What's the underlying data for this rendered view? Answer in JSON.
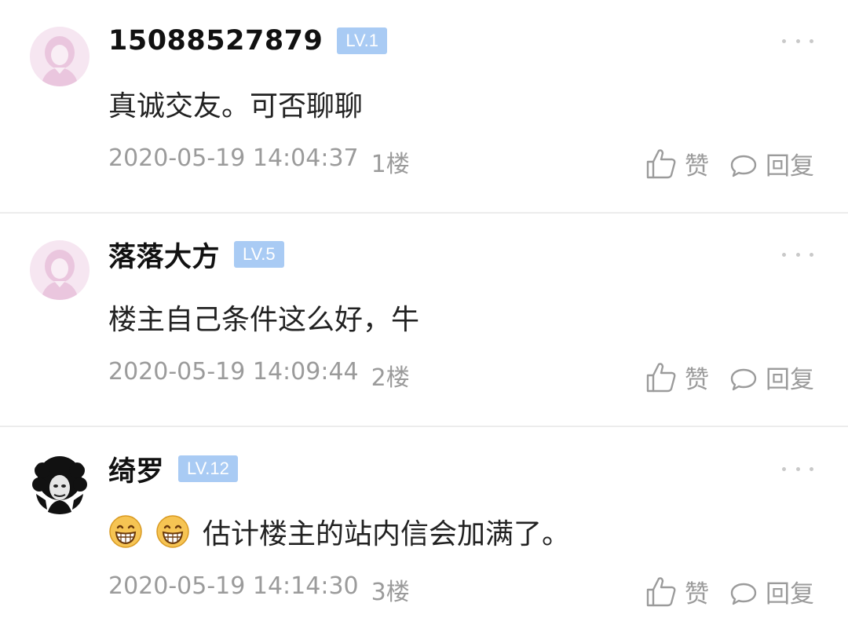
{
  "comments": [
    {
      "username": "15088527879",
      "level": "LV.1",
      "avatar": "female-silhouette-avatar",
      "emojis": [],
      "text": "真诚交友。可否聊聊",
      "timestamp": "2020-05-19 14:04:37",
      "floor": "1楼",
      "like_label": "赞",
      "reply_label": "回复"
    },
    {
      "username": "落落大方",
      "level": "LV.5",
      "avatar": "female-silhouette-avatar",
      "emojis": [],
      "text": "楼主自己条件这么好，牛",
      "timestamp": "2020-05-19 14:09:44",
      "floor": "2楼",
      "like_label": "赞",
      "reply_label": "回复"
    },
    {
      "username": "绮罗",
      "level": "LV.12",
      "avatar": "afro-portrait-avatar",
      "emojis": [
        "grinning-face-emoji",
        "grinning-face-emoji"
      ],
      "text": "估计楼主的站内信会加满了。",
      "timestamp": "2020-05-19 14:14:30",
      "floor": "3楼",
      "like_label": "赞",
      "reply_label": "回复"
    }
  ],
  "colors": {
    "level_badge": "#a9cbf4",
    "meta_text": "#9b9b9b",
    "avatar_pink": "#f0cfe6",
    "divider": "#ececec"
  }
}
